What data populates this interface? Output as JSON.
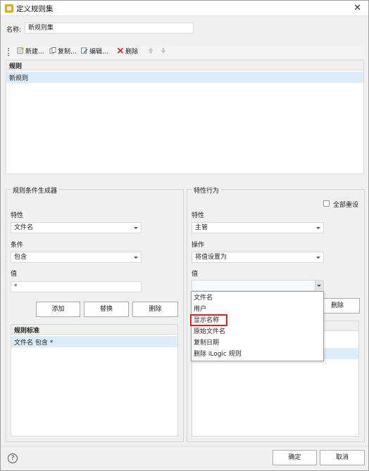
{
  "window": {
    "title": "定义规则集",
    "close_label": "✕"
  },
  "name_field": {
    "label": "名称:",
    "value": "新规则集"
  },
  "toolbar": {
    "new_label": "新建...",
    "copy_label": "复制...",
    "edit_label": "编辑...",
    "delete_label": "删除"
  },
  "rules_list": {
    "header": "规则",
    "rows": [
      "新规则"
    ]
  },
  "condition_builder": {
    "title": "规则条件生成器",
    "property_label": "特性",
    "property_value": "文件名",
    "condition_label": "条件",
    "condition_value": "包含",
    "value_label": "值",
    "value_value": "*",
    "add_label": "添加",
    "replace_label": "替换",
    "delete_label": "删除",
    "criteria_header": "规则标准",
    "criteria_rows": [
      "文件名 包含 *"
    ]
  },
  "property_behavior": {
    "title": "特性行为",
    "reset_all_label": "全部重设",
    "property_label": "特性",
    "property_value": "主管",
    "operation_label": "操作",
    "operation_value": "将值设置为",
    "value_label": "值",
    "value_value": "",
    "delete_label": "删除",
    "dropdown_options": [
      "文件名",
      "用户",
      "显示名称",
      "原始文件名",
      "复制日期",
      "删除 iLogic 规则"
    ]
  },
  "footer": {
    "ok_label": "确定",
    "cancel_label": "取消",
    "help_label": "?"
  },
  "colors": {
    "accent": "#dcecf9",
    "highlight": "#e21f26",
    "title_icon": "#e6a817"
  }
}
